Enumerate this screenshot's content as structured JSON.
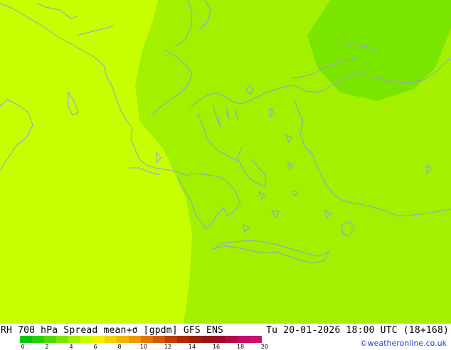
{
  "map": {
    "zone_colors": {
      "west": "#c8ff00",
      "central": "#a3f000",
      "east_patch": "#7ae600",
      "coastline": "#9a9ad8"
    }
  },
  "footer": {
    "title_left": "RH 700 hPa Spread mean+σ [gpdm] GFS ENS",
    "title_right": "Tu 20-01-2026 18:00 UTC (18+168)",
    "credit": "©weatheronline.co.uk",
    "colorbar": {
      "colors": [
        "#00c800",
        "#22d200",
        "#50dc00",
        "#7ae600",
        "#a3f000",
        "#c8ff00",
        "#f0f000",
        "#f0d200",
        "#f0b400",
        "#f09600",
        "#e07800",
        "#d05a00",
        "#c03c00",
        "#b42800",
        "#a01e0a",
        "#961414",
        "#a00a28",
        "#b40a46",
        "#c80a64",
        "#c8106e"
      ],
      "ticks": [
        "0",
        "2",
        "4",
        "6",
        "8",
        "10",
        "12",
        "14",
        "16",
        "18",
        "20"
      ]
    }
  }
}
